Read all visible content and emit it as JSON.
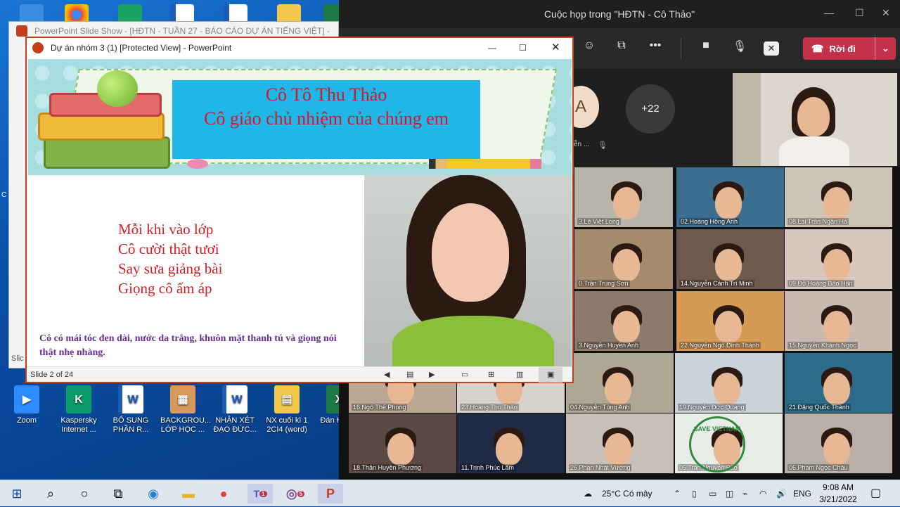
{
  "desktop": {
    "icons": [
      {
        "label": "Zoom",
        "color": "#2d8cff",
        "glyph": "▶"
      },
      {
        "label": "Kaspersky Internet ...",
        "color": "#0a9a6c",
        "glyph": "K"
      },
      {
        "label": "BỔ SUNG PHẦN R...",
        "color": "#ffffff",
        "glyph": "W"
      },
      {
        "label": "BACKGROU... LỚP HỌC ...",
        "color": "#d89a5a",
        "glyph": "▦"
      },
      {
        "label": "NHẬN XÉT ĐẠO ĐỨC...",
        "color": "#ffffff",
        "glyph": "W"
      },
      {
        "label": "NX cuối kì 1 2CI4 (word)",
        "color": "#f2c94c",
        "glyph": "▤"
      },
      {
        "label": "Đán HK1 c",
        "color": "#1d7a45",
        "glyph": "X"
      }
    ],
    "partial_left_labels": [
      "C",
      "Slic"
    ]
  },
  "ppt_back": {
    "title": "PowerPoint Slide Show - [HĐTN - TUẦN 27 - BÁO CÁO DỰ ÁN TIẾNG VIỆT] - Powe"
  },
  "ppt": {
    "title": "Dự án nhóm 3 (1) [Protected View] - PowerPoint",
    "slide": {
      "heading1": "Cô Tô Thu Thảo",
      "heading2": "Cô giáo chủ nhiệm của chúng em",
      "poem": [
        "Mỗi khi vào lớp",
        "Cô cười thật tươi",
        "Say sưa giảng bài",
        "Giọng cô ấm áp"
      ],
      "description": "Cô có mái tóc đen dài, nước da trắng, khuôn mặt thanh tú và giọng nói thật nhẹ nhàng."
    },
    "status": "Slide 2 of 24"
  },
  "teams": {
    "title": "Cuộc họp trong \"HĐTN - Cô Thảo\"",
    "leave_label": "Rời đi",
    "overflow_count": "+22",
    "avatar_initial": "A",
    "avatar_caption": "ễn ...",
    "participants": [
      "3.Lê Việt Long",
      "02.Hoàng Hồng Anh",
      "08.Lại Trần Ngân Hà",
      "0.Trần Trung Sơn",
      "14.Nguyễn Cảnh Trí Minh",
      "09.Đỗ Hoàng Bảo Hân",
      "3.Nguyễn Huyền Anh",
      "22.Nguyễn Ngô Đình Thành",
      "15.Nguyễn Khánh Ngọc",
      "16.Ngô Thế Phong",
      "23.Hoàng Thu Thảo",
      "04.Nguyễn Tùng Anh",
      "19.Nguyễn Đức Quang",
      "21.Đặng Quốc Thành",
      "18.Thân Huyền Phương",
      "11.Trịnh Phúc Lâm",
      "26.Phan Nhật Vượng",
      "05.Trần Nguyễn Bảo",
      "06.Phạm Ngọc Châu"
    ],
    "tile_colors": [
      "#b9b4aa",
      "#3c6e8f",
      "#cfc5b6",
      "#a58b6e",
      "#6f5a4e",
      "#d8c8c0",
      "#8c7b6a",
      "#d59a53",
      "#c9b9b0",
      "#bba894",
      "#d8d2cc",
      "#b0a694",
      "#cbd3da",
      "#2e6d8a",
      "#5b4a44",
      "#1f2a44",
      "#c8c0b6",
      "#e8ede7",
      "#b8b0a6"
    ],
    "save_text": "SAVE VIETNAM"
  },
  "taskbar": {
    "weather": "25°C  Có mây",
    "lang": "ENG",
    "time": "9:08 AM",
    "date": "3/21/2022",
    "teams_badge": "1",
    "viber_badge": "5"
  }
}
